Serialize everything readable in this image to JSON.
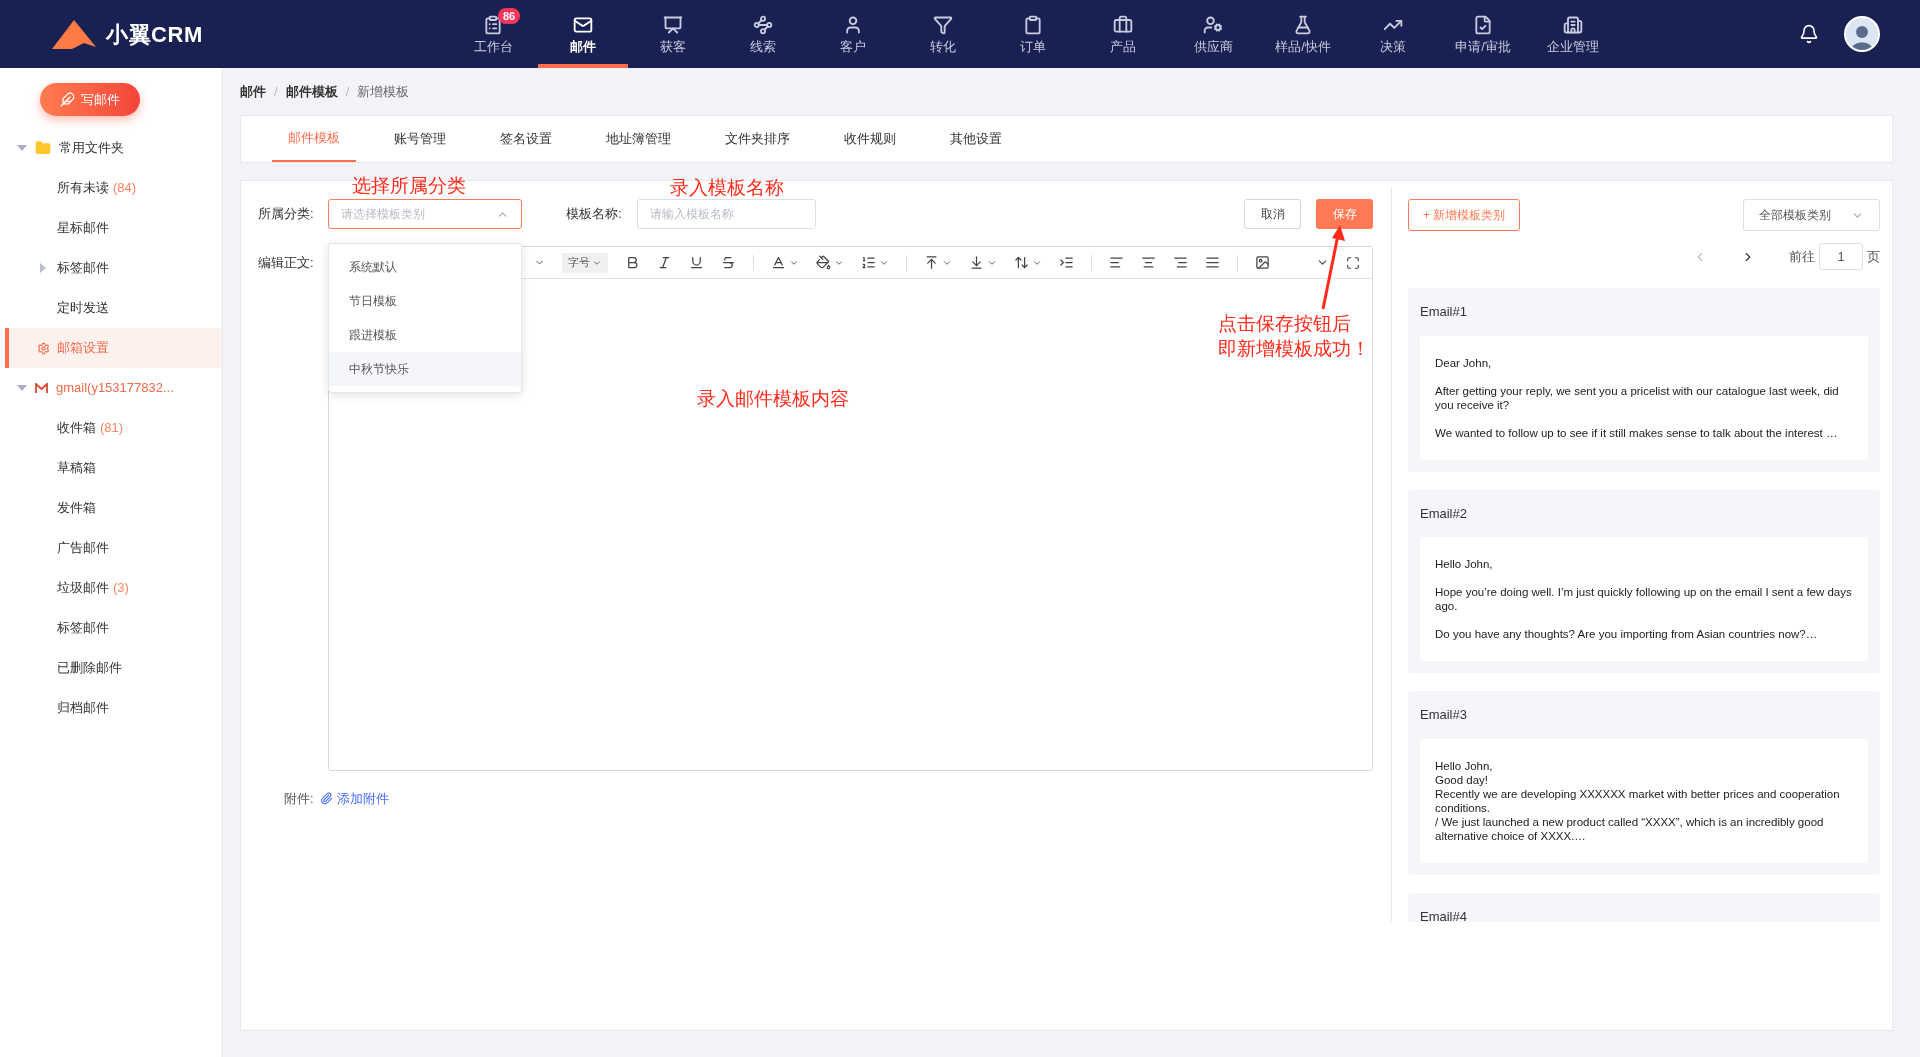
{
  "top_nav": {
    "logo": "小翼CRM",
    "items": [
      {
        "label": "工作台",
        "selected": false,
        "badge": "86",
        "kind": "desk"
      },
      {
        "label": "邮件",
        "selected": true,
        "kind": "mail"
      },
      {
        "label": "获客",
        "selected": false,
        "kind": "board"
      },
      {
        "label": "线索",
        "selected": false,
        "kind": "route"
      },
      {
        "label": "客户",
        "selected": false,
        "kind": "user"
      },
      {
        "label": "转化",
        "selected": false,
        "kind": "filter"
      },
      {
        "label": "订单",
        "selected": false,
        "kind": "clipboard"
      },
      {
        "label": "产品",
        "selected": false,
        "kind": "bag"
      },
      {
        "label": "供应商",
        "selected": false,
        "kind": "supplier"
      },
      {
        "label": "样品/快件",
        "selected": false,
        "kind": "flask"
      },
      {
        "label": "决策",
        "selected": false,
        "kind": "chart"
      },
      {
        "label": "申请/审批",
        "selected": false,
        "kind": "approve"
      },
      {
        "label": "企业管理",
        "selected": false,
        "kind": "building"
      }
    ]
  },
  "sidebar": {
    "compose_button": "写邮件",
    "tree": [
      {
        "label": "常用文件夹",
        "kind": "folder",
        "expanded": true,
        "children": [
          {
            "label": "所有未读",
            "count": "(84)",
            "selected": false
          },
          {
            "label": "星标邮件",
            "selected": false
          },
          {
            "label": "标签邮件",
            "expanded": false,
            "selected": false
          },
          {
            "label": "定时发送",
            "selected": false
          },
          {
            "label": "邮箱设置",
            "kind": "settings",
            "selected": true
          }
        ]
      },
      {
        "label": "gmail(y153177832...",
        "kind": "account",
        "expanded": true,
        "children": [
          {
            "label": "收件箱",
            "count": "(81)",
            "selected": false
          },
          {
            "label": "草稿箱",
            "selected": false
          },
          {
            "label": "发件箱",
            "selected": false
          },
          {
            "label": "广告邮件",
            "selected": false
          },
          {
            "label": "垃圾邮件",
            "count": "(3)",
            "selected": false
          },
          {
            "label": "标签邮件",
            "selected": false
          },
          {
            "label": "已删除邮件",
            "selected": false
          },
          {
            "label": "归档邮件",
            "selected": false
          }
        ]
      }
    ]
  },
  "breadcrumb": {
    "separator": "/",
    "items": [
      "邮件",
      "邮件模板",
      "新增模板"
    ]
  },
  "tabs": [
    {
      "label": "邮件模板",
      "selected": true
    },
    {
      "label": "账号管理",
      "selected": false
    },
    {
      "label": "签名设置",
      "selected": false
    },
    {
      "label": "地址簿管理",
      "selected": false
    },
    {
      "label": "文件夹排序",
      "selected": false
    },
    {
      "label": "收件规则",
      "selected": false
    },
    {
      "label": "其他设置",
      "selected": false
    }
  ],
  "form": {
    "category": {
      "label": "所属分类:",
      "placeholder": "请选择模板类别",
      "expanded": true,
      "options": [
        {
          "label": "系统默认",
          "highlighted": false
        },
        {
          "label": "节日模板",
          "highlighted": false
        },
        {
          "label": "跟进模板",
          "highlighted": false
        },
        {
          "label": "中秋节快乐",
          "highlighted": true
        }
      ]
    },
    "name": {
      "label": "模板名称:",
      "placeholder": "请输入模板名称"
    },
    "cancel_button": "取消",
    "save_button": "保存",
    "body_label": "编辑正文:",
    "font_size_select": "字号",
    "attachment": {
      "label": "附件:",
      "link": "添加附件"
    }
  },
  "annotations": [
    {
      "kind": "category",
      "lines": [
        "选择所属分类"
      ]
    },
    {
      "kind": "name",
      "lines": [
        "录入模板名称"
      ]
    },
    {
      "kind": "save",
      "lines": [
        "点击保存按钮后",
        "即新增模板成功！"
      ]
    },
    {
      "kind": "content",
      "lines": [
        "录入邮件模板内容"
      ]
    }
  ],
  "templates_panel": {
    "add_button": "+ 新增模板类别",
    "filter_select": "全部模板类别",
    "pagination": {
      "goto_label": "前往",
      "page": "1",
      "page_suffix": "页"
    },
    "templates": [
      {
        "title": "Email#1",
        "kind": "spaced",
        "lines": [
          "Dear John,",
          "After getting your reply, we sent you a pricelist with our catalogue last week, did you receive it?",
          "We wanted to follow up to see if it still makes sense to talk about the interest …"
        ]
      },
      {
        "title": "Email#2",
        "kind": "spaced",
        "lines": [
          "Hello John,",
          "Hope you’re doing well. I’m just quickly following up on the email I sent a few days ago.",
          "Do you have any thoughts? Are you importing from Asian countries now?…"
        ]
      },
      {
        "title": "Email#3",
        "kind": "compact",
        "lines": [
          "Hello John,",
          "Good day!",
          "Recently we are developing XXXXXX market with better prices and cooperation conditions.",
          "/ We just launched a new product called “XXXX”, which is an incredibly good alternative choice of XXXX.…"
        ]
      },
      {
        "title": "Email#4"
      }
    ]
  }
}
